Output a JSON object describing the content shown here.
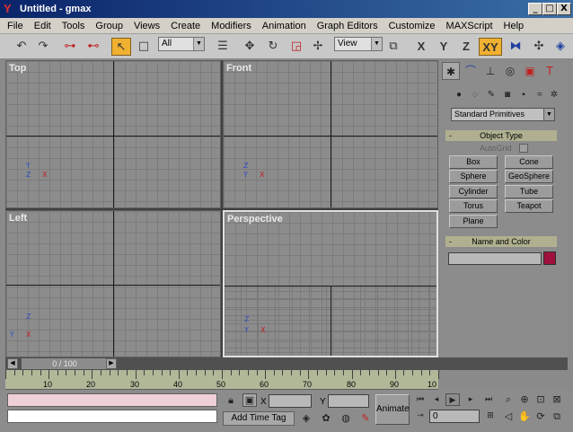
{
  "window": {
    "title": "Untitled - gmax",
    "app_icon": "gmax-logo",
    "minimize": "_",
    "maximize": "□",
    "close": "X"
  },
  "menu": [
    "File",
    "Edit",
    "Tools",
    "Group",
    "Views",
    "Create",
    "Modifiers",
    "Animation",
    "Graph Editors",
    "Customize",
    "MAXScript",
    "Help"
  ],
  "toolbar": {
    "selection_filter": "All",
    "reference_coord": "View",
    "axis": [
      "X",
      "Y",
      "Z",
      "XY"
    ],
    "active_axis": "XY",
    "icons": [
      "undo-icon",
      "redo-icon",
      "link-icon",
      "unlink-icon",
      "select-icon",
      "rect-region-icon",
      "select-by-name-icon",
      "move-icon",
      "rotate-icon",
      "scale-icon",
      "snap-icon",
      "named-selection-icon",
      "mirror-icon",
      "align-icon",
      "array-icon"
    ]
  },
  "viewports": {
    "top": "Top",
    "front": "Front",
    "left": "Left",
    "perspective": "Perspective",
    "active": "Perspective"
  },
  "command_panel": {
    "tabs": [
      "create-icon",
      "modify-icon",
      "hierarchy-icon",
      "motion-icon",
      "display-icon",
      "utilities-icon"
    ],
    "active_tab": "create-icon",
    "categories": [
      "geometry-icon",
      "shapes-icon",
      "lights-icon",
      "cameras-icon",
      "helpers-icon",
      "spacewarps-icon",
      "systems-icon"
    ],
    "dropdown": "Standard Primitives",
    "object_type": {
      "header": "Object Type",
      "autogrid": "AutoGrid",
      "buttons": [
        "Box",
        "Cone",
        "Sphere",
        "GeoSphere",
        "Cylinder",
        "Tube",
        "Torus",
        "Teapot",
        "Plane"
      ]
    },
    "name_color": {
      "header": "Name and Color",
      "color": "#a0103c"
    }
  },
  "timeline": {
    "frame_counter": "0 / 100",
    "ruler_labels": [
      "10",
      "20",
      "30",
      "40",
      "50",
      "60",
      "70",
      "80",
      "90",
      "10"
    ]
  },
  "status": {
    "x_label": "X",
    "y_label": "Y",
    "add_time_tag": "Add Time Tag",
    "animate": "Animate",
    "current_frame": "0"
  }
}
